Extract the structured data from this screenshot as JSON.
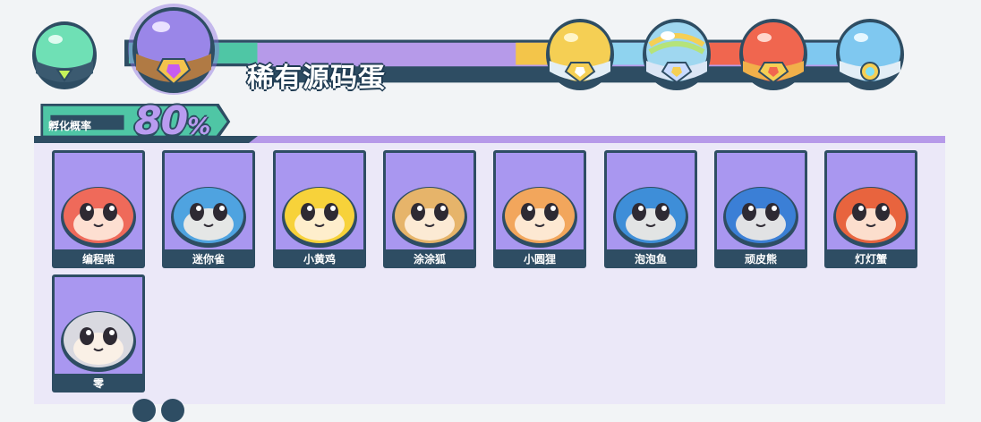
{
  "header": {
    "title": "稀有源码蛋",
    "eggs": [
      {
        "icon": "green-egg-icon",
        "color": "#5fd1a3"
      },
      {
        "icon": "purple-egg-icon",
        "color": "#9a86e8",
        "selected": true
      },
      {
        "icon": "gold-egg-icon",
        "color": "#f3c54a"
      },
      {
        "icon": "rainbow-egg-icon",
        "color": "#9fd7f0"
      },
      {
        "icon": "red-egg-icon",
        "color": "#f0664f"
      },
      {
        "icon": "blue-egg-icon",
        "color": "#7fc8f0"
      }
    ]
  },
  "rate": {
    "label": "孵化概率",
    "value": "80",
    "unit": "%"
  },
  "pets": [
    {
      "name": "编程喵",
      "color": "#ef6a5a"
    },
    {
      "name": "迷你雀",
      "color": "#4fa3e0"
    },
    {
      "name": "小黄鸡",
      "color": "#f7d23a"
    },
    {
      "name": "涂涂狐",
      "color": "#e6b46a"
    },
    {
      "name": "小圆狸",
      "color": "#f2a65c"
    },
    {
      "name": "泡泡鱼",
      "color": "#3e8ed8"
    },
    {
      "name": "顽皮熊",
      "color": "#3b7fd6"
    },
    {
      "name": "灯灯蟹",
      "color": "#e8643e"
    },
    {
      "name": "零",
      "color": "#d9d9e0"
    }
  ],
  "colors": {
    "accent": "#b69ae9",
    "dark": "#2e4d63",
    "card_bg": "#a997f0",
    "panel_bg": "#ebe8f8"
  }
}
